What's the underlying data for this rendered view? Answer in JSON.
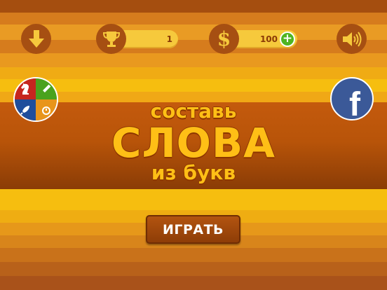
{
  "top_bar": {
    "download_icon": "arrow-down-icon",
    "trophy_icon": "trophy-icon",
    "trophy_count": "1",
    "coin_icon": "dollar-icon",
    "coin_count": "100",
    "add_coins_label": "+",
    "sound_icon": "speaker-icon"
  },
  "side": {
    "modes_icon": "game-modes-icon",
    "facebook_label": "f"
  },
  "logo": {
    "line1": "составь",
    "line2": "СЛОВА",
    "line3": "из букв"
  },
  "play_button_label": "ИГРАТЬ",
  "colors": {
    "accent_yellow": "#ffbf16",
    "icon_bg": "#a64f12",
    "facebook_blue": "#3b5998"
  }
}
